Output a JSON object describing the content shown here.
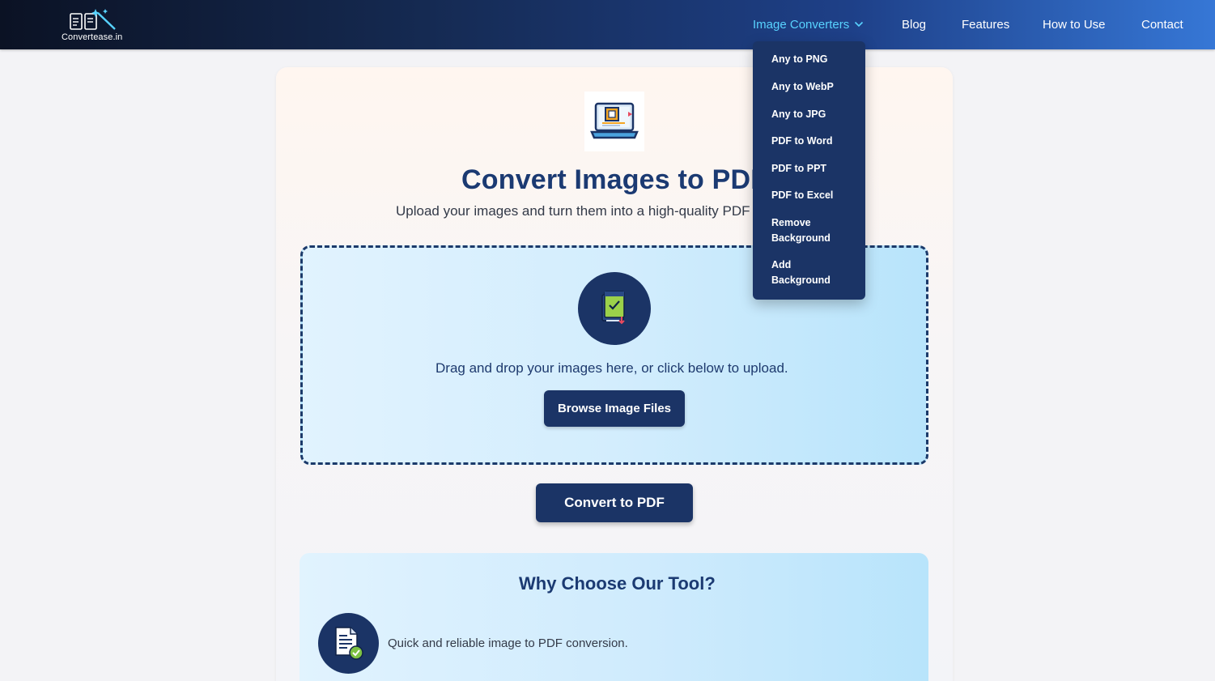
{
  "nav": {
    "logo_text": "Converteasе.in",
    "links": [
      "Image Converters",
      "Blog",
      "Features",
      "How to Use",
      "Contact"
    ],
    "active_color": "#58d3ff"
  },
  "dropdown": {
    "items": [
      "Any to PNG",
      "Any to WebP",
      "Any to JPG",
      "PDF to Word",
      "PDF to PPT",
      "PDF to Excel",
      "Remove Background",
      "Add Background"
    ]
  },
  "hero": {
    "title": "Convert Images to PDF",
    "subtitle": "Upload your images and turn them into a high-quality PDF file."
  },
  "upload": {
    "drop_text": "Drag and drop your images here, or click below to upload.",
    "browse_label": "Browse Image Files"
  },
  "convert": {
    "label": "Convert to PDF"
  },
  "why": {
    "title": "Why Choose Our Tool?",
    "features": [
      "Quick and reliable image to PDF conversion."
    ]
  },
  "colors": {
    "navy": "#1b3466",
    "title": "#1b3a72",
    "accent": "#58d3ff"
  },
  "icons": [
    "logo-icon",
    "chevron-down-icon",
    "laptop-image-icon",
    "upload-document-icon",
    "document-check-icon"
  ]
}
